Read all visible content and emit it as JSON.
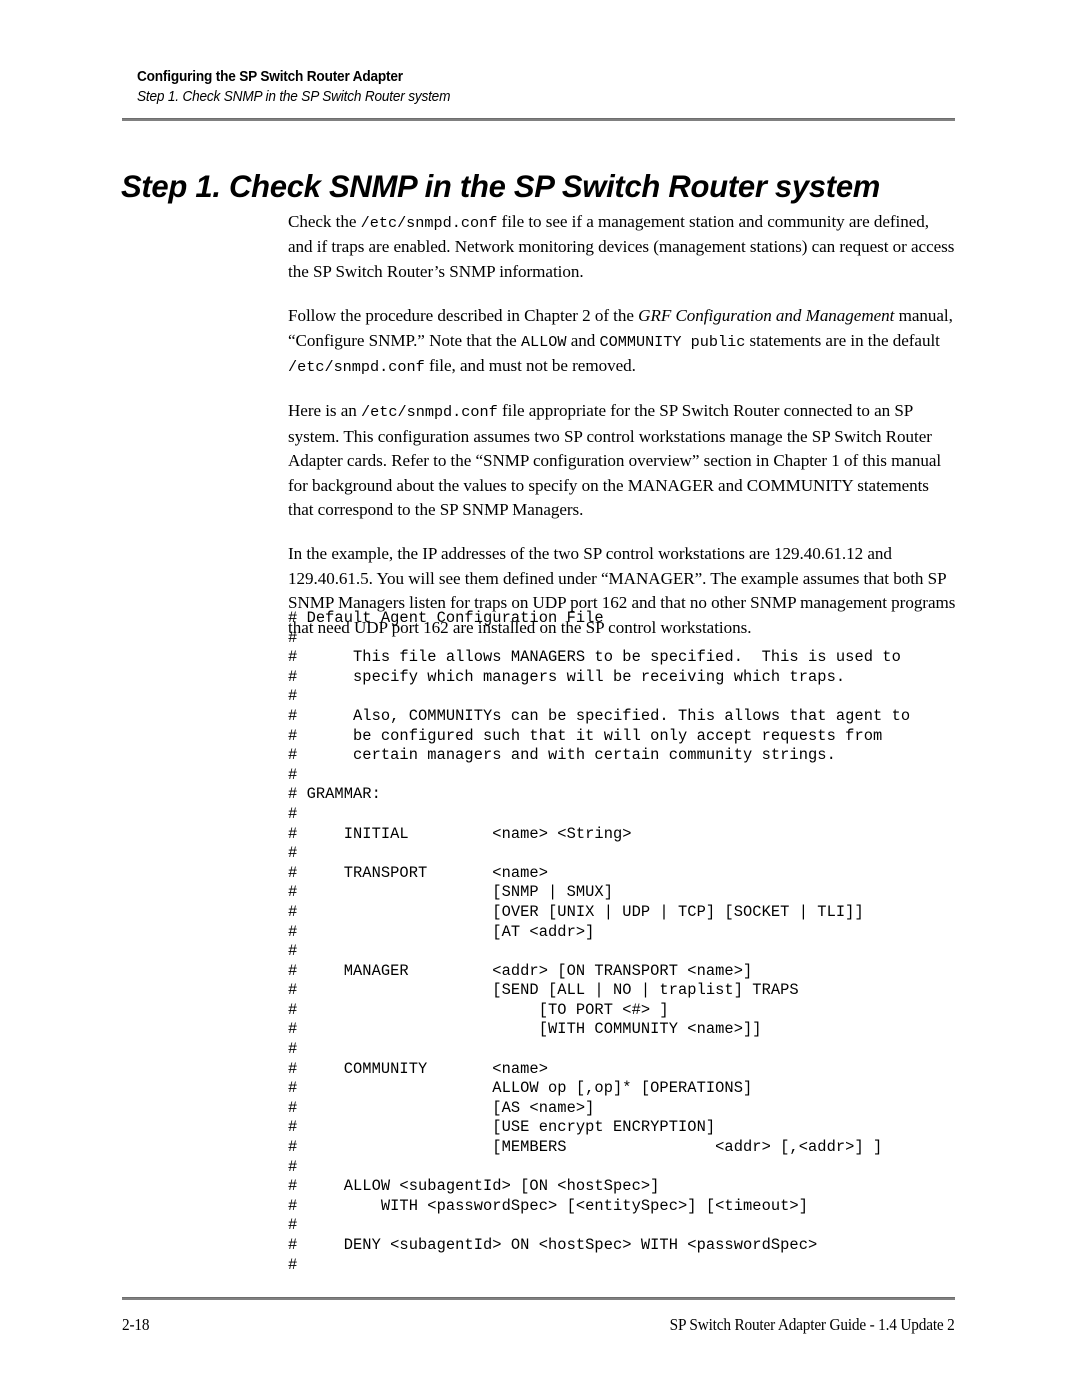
{
  "running_head": {
    "chapter_title": "Configuring the SP Switch Router Adapter",
    "section_title": "Step 1. Check SNMP in the SP Switch Router system"
  },
  "heading": "Step 1.  Check SNMP in the SP Switch Router system",
  "paragraphs": {
    "p1": {
      "seg1": "Check the ",
      "code1": "/etc/snmpd.conf",
      "seg2": " file to see if a management station and community are defined, and if traps are enabled. Network monitoring devices (management stations) can request or access the SP Switch Router’s SNMP information."
    },
    "p2": {
      "seg1": "Follow the procedure described in Chapter 2 of the ",
      "italic1": "GRF Configuration and Management",
      "seg2": " manual, “Configure SNMP.” Note that the ",
      "code1": "ALLOW",
      "seg3": " and ",
      "code2": "COMMUNITY public",
      "seg4": " statements are in the default ",
      "code3": "/etc/snmpd.conf",
      "seg5": " file, and must not be removed."
    },
    "p3": {
      "seg1": "Here is an ",
      "code1": "/etc/snmpd.conf",
      "seg2": " file appropriate for the SP Switch Router connected to an SP system. This configuration assumes two SP control workstations manage the SP Switch Router Adapter cards. Refer to the “SNMP configuration overview” section in Chapter 1 of this manual for background about the values to specify on the MANAGER and COMMUNITY statements that correspond to the SP SNMP Managers."
    },
    "p4": {
      "text": "In the example, the IP addresses of the two SP control workstations are 129.40.61.12 and 129.40.61.5. You will see them defined under “MANAGER”.  The example assumes that both SP SNMP Managers listen for traps on UDP port 162 and that no other SNMP management programs that need UDP port 162 are installed on the SP control workstations."
    }
  },
  "code_block": {
    "filename": "/etc/snmpd.conf",
    "lines": [
      "# Default Agent Configuration File",
      "#",
      "#      This file allows MANAGERS to be specified.  This is used to",
      "#      specify which managers will be receiving which traps.",
      "#",
      "#      Also, COMMUNITYs can be specified. This allows that agent to",
      "#      be configured such that it will only accept requests from",
      "#      certain managers and with certain community strings.",
      "#",
      "# GRAMMAR:",
      "#",
      "#     INITIAL         <name> <String>",
      "#",
      "#     TRANSPORT       <name>",
      "#                     [SNMP | SMUX]",
      "#                     [OVER [UNIX | UDP | TCP] [SOCKET | TLI]]",
      "#                     [AT <addr>]",
      "#",
      "#     MANAGER         <addr> [ON TRANSPORT <name>]",
      "#                     [SEND [ALL | NO | traplist] TRAPS",
      "#                          [TO PORT <#> ]",
      "#                          [WITH COMMUNITY <name>]]",
      "#",
      "#     COMMUNITY       <name>",
      "#                     ALLOW op [,op]* [OPERATIONS]",
      "#                     [AS <name>]",
      "#                     [USE encrypt ENCRYPTION]",
      "#                     [MEMBERS                <addr> [,<addr>] ]",
      "#",
      "#     ALLOW <subagentId> [ON <hostSpec>]",
      "#         WITH <passwordSpec> [<entitySpec>] [<timeout>]",
      "#",
      "#     DENY <subagentId> ON <hostSpec> WITH <passwordSpec>",
      "#"
    ]
  },
  "footer": {
    "page_number": "2-18",
    "guide_title": "SP Switch Router Adapter Guide - 1.4 Update 2"
  },
  "colors": {
    "text": "#000000",
    "rule": "#808080",
    "background": "#ffffff"
  }
}
